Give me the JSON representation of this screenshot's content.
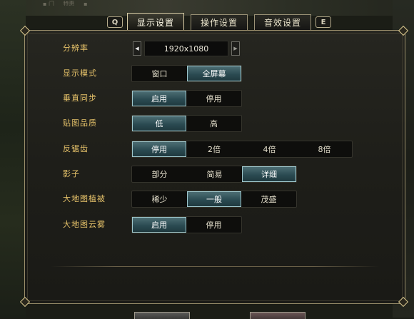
{
  "background_top": [
    "▪ 门",
    "特惠",
    "▪"
  ],
  "nav": {
    "prev_key": "Q",
    "next_key": "E",
    "tabs": [
      {
        "label": "显示设置",
        "active": true
      },
      {
        "label": "操作设置",
        "active": false
      },
      {
        "label": "音效设置",
        "active": false
      }
    ]
  },
  "settings": {
    "resolution": {
      "label": "分辨率",
      "value": "1920x1080"
    },
    "display_mode": {
      "label": "显示模式",
      "options": [
        "窗口",
        "全屏幕"
      ],
      "selected": 1
    },
    "vsync": {
      "label": "垂直同步",
      "options": [
        "启用",
        "停用"
      ],
      "selected": 0
    },
    "texture_quality": {
      "label": "贴图品质",
      "options": [
        "低",
        "高"
      ],
      "selected": 0
    },
    "antialiasing": {
      "label": "反锯齿",
      "options": [
        "停用",
        "2倍",
        "4倍",
        "8倍"
      ],
      "selected": 0
    },
    "shadow": {
      "label": "影子",
      "options": [
        "部分",
        "简易",
        "详细"
      ],
      "selected": 2
    },
    "map_vegetation": {
      "label": "大地图植被",
      "options": [
        "稀少",
        "一般",
        "茂盛"
      ],
      "selected": 1
    },
    "map_clouds": {
      "label": "大地图云雾",
      "options": [
        "启用",
        "停用"
      ],
      "selected": 0
    }
  },
  "colors": {
    "label": "#e6c26a",
    "selected_fill": "#2b4b52",
    "selected_border": "#9fc7cc",
    "panel_border": "#9b8f6b"
  }
}
